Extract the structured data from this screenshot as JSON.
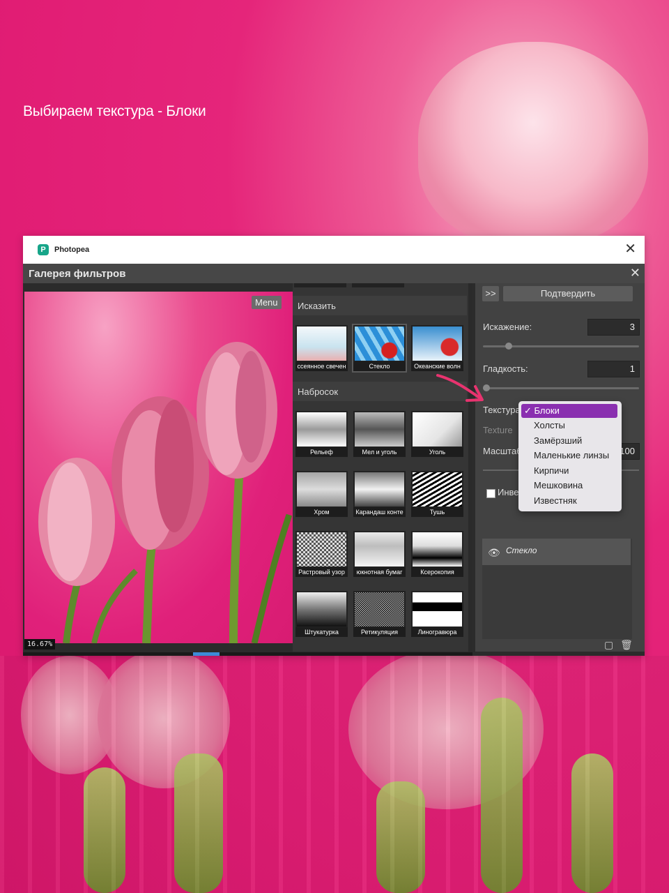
{
  "caption": "Выбираем текстура - Блоки",
  "window": {
    "title": "Photopea",
    "close_glyph": "✕"
  },
  "dialog": {
    "title": "Галерея фильтров",
    "close_glyph": "✕"
  },
  "preview": {
    "menu_label": "Menu",
    "zoom": "16.67%"
  },
  "gallery": {
    "sections": [
      {
        "title": "Исказить",
        "items": [
          "Рассеянное свечение",
          "Стекло",
          "Океанские волны"
        ]
      },
      {
        "title": "Набросок",
        "items": [
          "Рельеф",
          "Мел и уголь",
          "Уголь",
          "Хром",
          "Карандаш контур",
          "Тушь",
          "Растровый узор",
          "Почтовая бумага",
          "Ксерокопия",
          "Штукатурка",
          "Ретикуляция",
          "Линогравюра"
        ]
      }
    ],
    "visible_labels": [
      "ссеянное свечен",
      "Стекло",
      "Океанские волн",
      "Рельеф",
      "Мел и уголь",
      "Уголь",
      "Хром",
      "Карандаш конте",
      "Тушь",
      "Растровый узор",
      "юкнотная бумаг",
      "Ксерокопия",
      "Штукатурка",
      "Ретикуляция",
      "Линогравюра"
    ]
  },
  "panel": {
    "expand_label": ">>",
    "confirm_label": "Подтвердить",
    "distortion": {
      "label": "Искажение:",
      "value": "3"
    },
    "smoothness": {
      "label": "Гладкость:",
      "value": "1"
    },
    "texture": {
      "label": "Текстура",
      "value": "Блоки"
    },
    "texture_file_label": "Texture",
    "scale": {
      "label": "Масштаб",
      "value": "100"
    },
    "invert_label": "Инвертировать",
    "layer_name": "Стекло"
  },
  "dropdown": {
    "options": [
      "Блоки",
      "Холсты",
      "Замёрзший",
      "Маленькие линзы",
      "Кирпичи",
      "Мешковина",
      "Известняк"
    ],
    "selected_index": 0,
    "check_glyph": "✓"
  },
  "colors": {
    "accent_arrow": "#e8336f",
    "dropdown_highlight": "#8a2fb0",
    "background_pink": "#e11d74"
  }
}
